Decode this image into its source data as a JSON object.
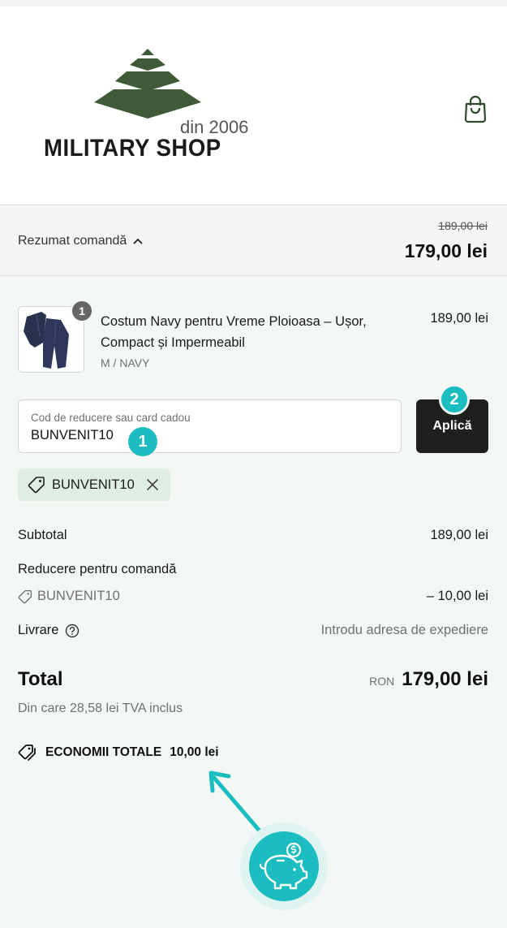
{
  "header": {
    "logo_since": "din 2006",
    "logo_name": "MILITARY SHOP"
  },
  "summary": {
    "toggle_label": "Rezumat comandă",
    "old_price": "189,00 lei",
    "new_price": "179,00 lei"
  },
  "product": {
    "quantity": "1",
    "name": "Costum Navy pentru Vreme Ploioasa – Ușor, Compact și Impermeabil",
    "variant": "M / NAVY",
    "price": "189,00 lei"
  },
  "discount": {
    "placeholder": "Cod de reducere sau card cadou",
    "value": "BUNVENIT10",
    "apply_label": "Aplică",
    "applied_code": "BUNVENIT10"
  },
  "annotations": {
    "step1": "1",
    "step2": "2"
  },
  "totals": {
    "subtotal_label": "Subtotal",
    "subtotal_value": "189,00 lei",
    "discount_label": "Reducere pentru comandă",
    "discount_code": "BUNVENIT10",
    "discount_value": "– 10,00 lei",
    "shipping_label": "Livrare",
    "shipping_value": "Introdu adresa de expediere",
    "total_label": "Total",
    "currency": "RON",
    "total_value": "179,00 lei",
    "vat_note": "Din care 28,58 lei TVA inclus",
    "savings_label": "ECONOMII TOTALE",
    "savings_value": "10,00 lei"
  },
  "colors": {
    "accent": "#1bbdc0",
    "logo_green": "#3f5a36",
    "panel_bg": "#f3f8f4",
    "button_bg": "#1f1f1f"
  },
  "icons": [
    "shopping-bag-icon",
    "chevron-up-icon",
    "tag-icon",
    "close-icon",
    "help-circle-icon",
    "tags-icon",
    "piggy-bank-icon",
    "arrow-icon"
  ]
}
